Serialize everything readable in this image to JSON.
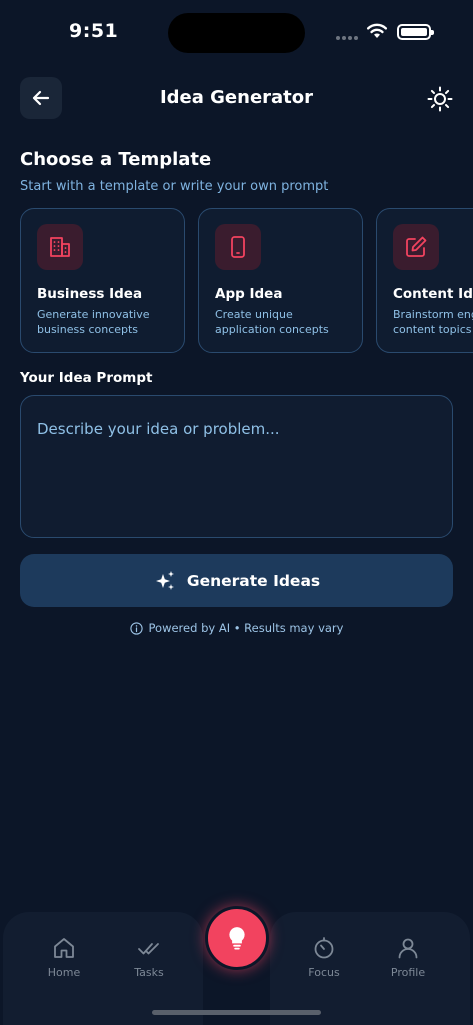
{
  "status_bar": {
    "time": "9:51"
  },
  "header": {
    "title": "Idea Generator"
  },
  "templates_section": {
    "title": "Choose a Template",
    "subtitle": "Start with a template or write your own prompt"
  },
  "templates": [
    {
      "title": "Business Idea",
      "desc_line1": "Generate innovative",
      "desc_line2": "business concepts",
      "icon": "building-icon"
    },
    {
      "title": "App Idea",
      "desc_line1": "Create unique",
      "desc_line2": "application concepts",
      "icon": "smartphone-icon"
    },
    {
      "title": "Content Idea",
      "desc_line1": "Brainstorm engaging",
      "desc_line2": "content topics",
      "icon": "edit-icon"
    }
  ],
  "prompt": {
    "label": "Your Idea Prompt",
    "placeholder": "Describe your idea or problem...",
    "value": ""
  },
  "generate_button": {
    "label": "Generate Ideas"
  },
  "footer_note": "Powered by AI • Results may vary",
  "bottom_nav": {
    "items": [
      {
        "label": "Home",
        "icon": "home-icon"
      },
      {
        "label": "Tasks",
        "icon": "double-check-icon"
      },
      {
        "label": "Focus",
        "icon": "timer-icon"
      },
      {
        "label": "Profile",
        "icon": "user-icon"
      }
    ],
    "center_icon": "lightbulb-icon"
  },
  "colors": {
    "background": "#0c1628",
    "accent": "#f2435f",
    "card_border": "#2a4a6e",
    "button": "#1d3a5c",
    "subtext": "#8fc0e6"
  }
}
